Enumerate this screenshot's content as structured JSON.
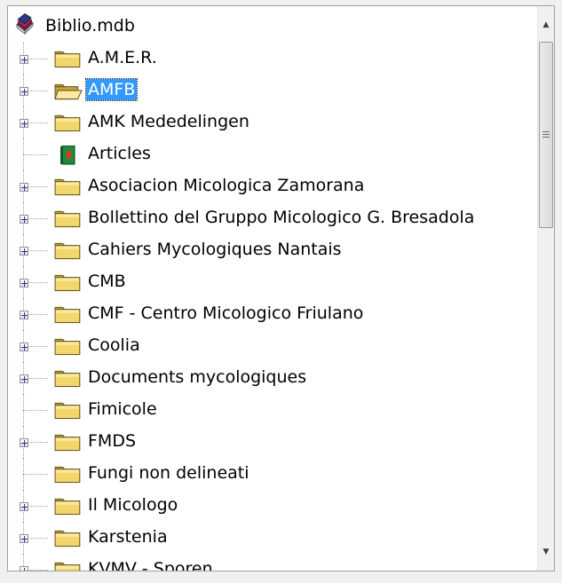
{
  "tree": {
    "root": {
      "label": "Biblio.mdb",
      "icon": "database-books-icon"
    },
    "items": [
      {
        "label": "A.M.E.R.",
        "icon": "folder-closed-icon",
        "expandable": true,
        "selected": false
      },
      {
        "label": "AMFB",
        "icon": "folder-open-icon",
        "expandable": true,
        "selected": true
      },
      {
        "label": "AMK Mededelingen",
        "icon": "folder-closed-icon",
        "expandable": true,
        "selected": false
      },
      {
        "label": "Articles",
        "icon": "green-book-icon",
        "expandable": false,
        "selected": false
      },
      {
        "label": "Asociacion Micologica Zamorana",
        "icon": "folder-closed-icon",
        "expandable": true,
        "selected": false
      },
      {
        "label": "Bollettino del Gruppo Micologico G. Bresadola",
        "icon": "folder-closed-icon",
        "expandable": true,
        "selected": false
      },
      {
        "label": "Cahiers Mycologiques Nantais",
        "icon": "folder-closed-icon",
        "expandable": true,
        "selected": false
      },
      {
        "label": "CMB",
        "icon": "folder-closed-icon",
        "expandable": true,
        "selected": false
      },
      {
        "label": "CMF - Centro Micologico Friulano",
        "icon": "folder-closed-icon",
        "expandable": true,
        "selected": false
      },
      {
        "label": "Coolia",
        "icon": "folder-closed-icon",
        "expandable": true,
        "selected": false
      },
      {
        "label": "Documents mycologiques",
        "icon": "folder-closed-icon",
        "expandable": true,
        "selected": false
      },
      {
        "label": "Fimicole",
        "icon": "folder-closed-icon",
        "expandable": false,
        "selected": false
      },
      {
        "label": "FMDS",
        "icon": "folder-closed-icon",
        "expandable": true,
        "selected": false
      },
      {
        "label": "Fungi non delineati",
        "icon": "folder-closed-icon",
        "expandable": false,
        "selected": false
      },
      {
        "label": "Il Micologo",
        "icon": "folder-closed-icon",
        "expandable": true,
        "selected": false
      },
      {
        "label": "Karstenia",
        "icon": "folder-closed-icon",
        "expandable": true,
        "selected": false
      },
      {
        "label": "KVMV - Sporen",
        "icon": "folder-closed-icon",
        "expandable": true,
        "selected": false
      }
    ]
  },
  "scrollbar": {
    "up_glyph": "▲",
    "down_glyph": "▼",
    "position": 0.0
  },
  "colors": {
    "selection": "#3399ff",
    "folder": "#f2d66b",
    "folder_dark": "#c9a43a",
    "book_green": "#1e8a3c",
    "book_red": "#d63a1f"
  }
}
